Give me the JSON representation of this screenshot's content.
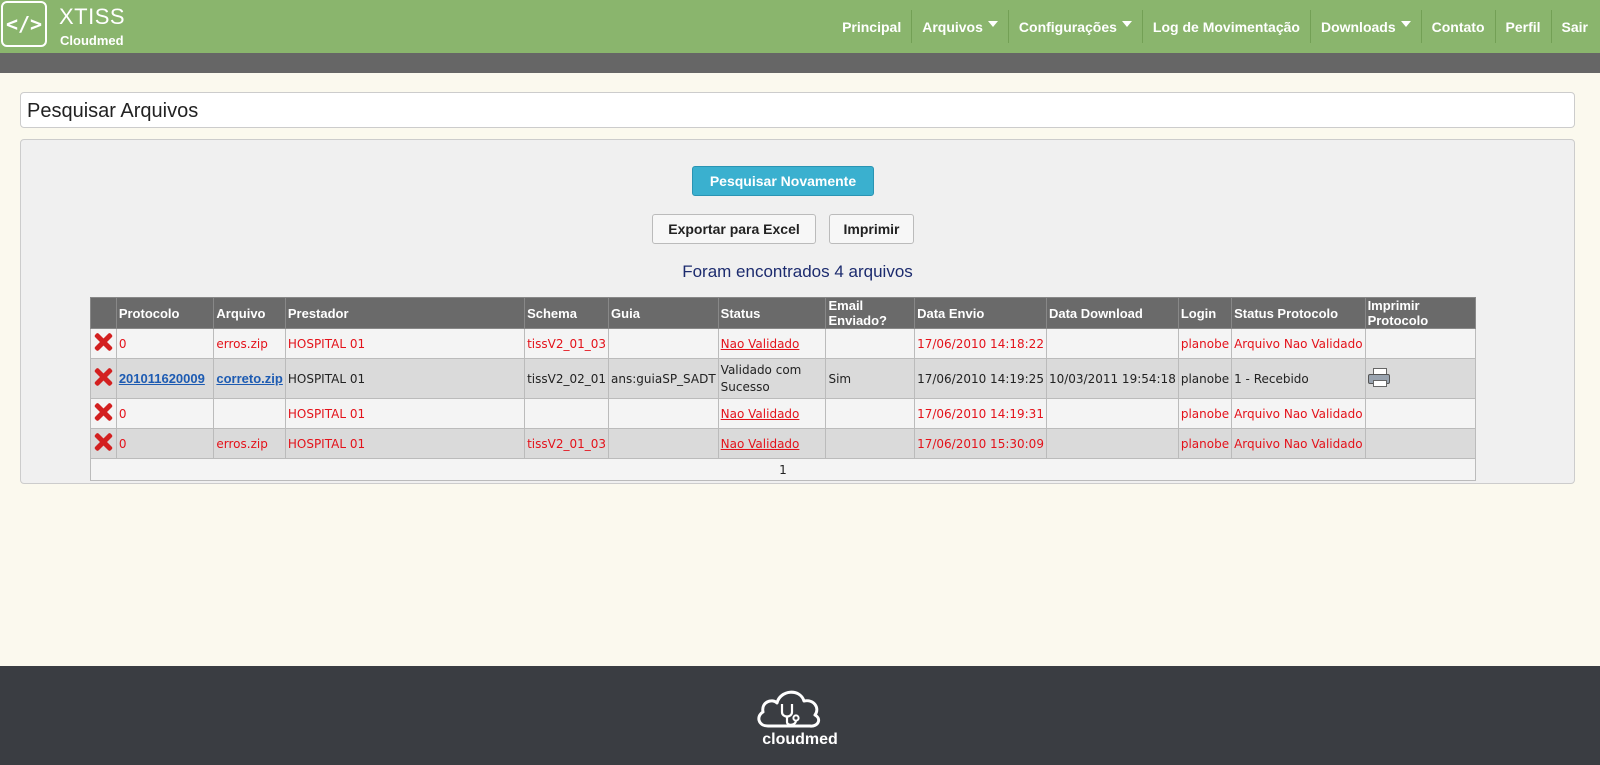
{
  "header": {
    "logo_glyph": "</>",
    "brand_title": "XTISS",
    "brand_subtitle": "Cloudmed",
    "nav": [
      {
        "label": "Principal",
        "dropdown": false
      },
      {
        "label": "Arquivos",
        "dropdown": true
      },
      {
        "label": "Configurações",
        "dropdown": true
      },
      {
        "label": "Log de Movimentação",
        "dropdown": false
      },
      {
        "label": "Downloads",
        "dropdown": true
      },
      {
        "label": "Contato",
        "dropdown": false
      },
      {
        "label": "Perfil",
        "dropdown": false
      },
      {
        "label": "Sair",
        "dropdown": false
      }
    ]
  },
  "page": {
    "title": "Pesquisar Arquivos"
  },
  "actions": {
    "search_again": "Pesquisar Novamente",
    "export_excel": "Exportar para Excel",
    "print": "Imprimir"
  },
  "results": {
    "summary": "Foram encontrados 4 arquivos",
    "columns": [
      "",
      "Protocolo",
      "Arquivo",
      "Prestador",
      "Schema",
      "Guia",
      "Status",
      "Email Enviado?",
      "Data Envio",
      "Data Download",
      "Login",
      "Status Protocolo",
      "Imprimir Protocolo"
    ],
    "rows": [
      {
        "protocolo": "0",
        "arquivo": "erros.zip",
        "prestador": "HOSPITAL 01",
        "schema": "tissV2_01_03",
        "guia": "",
        "status": "Nao Validado",
        "email": "",
        "data_envio": "17/06/2010 14:18:22",
        "data_download": "",
        "login": "planobe",
        "status_protocolo": "Arquivo Nao Validado"
      },
      {
        "protocolo": "201011620009",
        "arquivo": "correto.zip",
        "prestador": "HOSPITAL 01",
        "schema": "tissV2_02_01",
        "guia": "ans:guiaSP_SADT",
        "status": "Validado com Sucesso",
        "email": "Sim",
        "data_envio": "17/06/2010 14:19:25",
        "data_download": "10/03/2011 19:54:18",
        "login": "planobe",
        "status_protocolo": "1 - Recebido"
      },
      {
        "protocolo": "0",
        "arquivo": "",
        "prestador": "HOSPITAL 01",
        "schema": "",
        "guia": "",
        "status": "Nao Validado",
        "email": "",
        "data_envio": "17/06/2010 14:19:31",
        "data_download": "",
        "login": "planobe",
        "status_protocolo": "Arquivo Nao Validado"
      },
      {
        "protocolo": "0",
        "arquivo": "erros.zip",
        "prestador": "HOSPITAL 01",
        "schema": "tissV2_01_03",
        "guia": "",
        "status": "Nao Validado",
        "email": "",
        "data_envio": "17/06/2010 15:30:09",
        "data_download": "",
        "login": "planobe",
        "status_protocolo": "Arquivo Nao Validado"
      }
    ],
    "pager": "1"
  },
  "footer": {
    "brand": "cloudmed"
  },
  "colors": {
    "header_green": "#8ab56d",
    "error_red": "#e4121a",
    "link_blue": "#1d5bb2",
    "primary_button": "#3ab0cf",
    "footer_dark": "#3a3d42"
  },
  "icons": {
    "delete": "delete-icon",
    "printer": "printer-icon",
    "cloud": "cloud-stethoscope-icon"
  }
}
